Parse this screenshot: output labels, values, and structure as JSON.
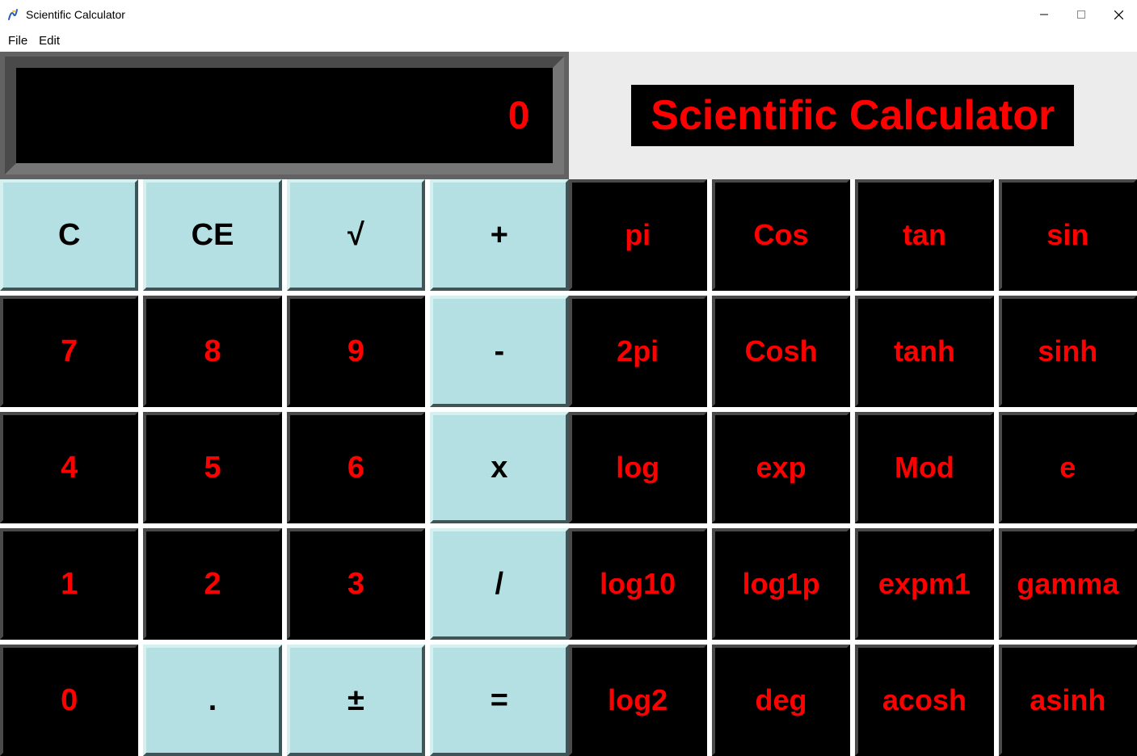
{
  "window": {
    "title": "Scientific Calculator"
  },
  "menu": {
    "file": "File",
    "edit": "Edit"
  },
  "display": {
    "value": "0"
  },
  "heading": "Scientific Calculator",
  "left_grid": [
    [
      {
        "label": "C",
        "style": "teal",
        "name": "clear-button"
      },
      {
        "label": "CE",
        "style": "teal",
        "name": "clear-entry-button"
      },
      {
        "label": "√",
        "style": "teal",
        "name": "sqrt-button"
      },
      {
        "label": "+",
        "style": "teal",
        "name": "plus-button"
      }
    ],
    [
      {
        "label": "7",
        "style": "black",
        "name": "digit-7-button"
      },
      {
        "label": "8",
        "style": "black",
        "name": "digit-8-button"
      },
      {
        "label": "9",
        "style": "black",
        "name": "digit-9-button"
      },
      {
        "label": "-",
        "style": "teal",
        "name": "minus-button"
      }
    ],
    [
      {
        "label": "4",
        "style": "black",
        "name": "digit-4-button"
      },
      {
        "label": "5",
        "style": "black",
        "name": "digit-5-button"
      },
      {
        "label": "6",
        "style": "black",
        "name": "digit-6-button"
      },
      {
        "label": "x",
        "style": "teal",
        "name": "multiply-button"
      }
    ],
    [
      {
        "label": "1",
        "style": "black",
        "name": "digit-1-button"
      },
      {
        "label": "2",
        "style": "black",
        "name": "digit-2-button"
      },
      {
        "label": "3",
        "style": "black",
        "name": "digit-3-button"
      },
      {
        "label": "/",
        "style": "teal",
        "name": "divide-button"
      }
    ],
    [
      {
        "label": "0",
        "style": "black",
        "name": "digit-0-button"
      },
      {
        "label": ".",
        "style": "teal",
        "name": "decimal-button"
      },
      {
        "label": "±",
        "style": "teal",
        "name": "plus-minus-button"
      },
      {
        "label": "=",
        "style": "teal",
        "name": "equals-button"
      }
    ]
  ],
  "right_grid": [
    [
      {
        "label": "pi",
        "name": "pi-button"
      },
      {
        "label": "Cos",
        "name": "cos-button"
      },
      {
        "label": "tan",
        "name": "tan-button"
      },
      {
        "label": "sin",
        "name": "sin-button"
      }
    ],
    [
      {
        "label": "2pi",
        "name": "two-pi-button"
      },
      {
        "label": "Cosh",
        "name": "cosh-button"
      },
      {
        "label": "tanh",
        "name": "tanh-button"
      },
      {
        "label": "sinh",
        "name": "sinh-button"
      }
    ],
    [
      {
        "label": "log",
        "name": "log-button"
      },
      {
        "label": "exp",
        "name": "exp-button"
      },
      {
        "label": "Mod",
        "name": "mod-button"
      },
      {
        "label": "e",
        "name": "e-button"
      }
    ],
    [
      {
        "label": "log10",
        "name": "log10-button"
      },
      {
        "label": "log1p",
        "name": "log1p-button"
      },
      {
        "label": "expm1",
        "name": "expm1-button"
      },
      {
        "label": "gamma",
        "name": "gamma-button"
      }
    ],
    [
      {
        "label": "log2",
        "name": "log2-button"
      },
      {
        "label": "deg",
        "name": "deg-button"
      },
      {
        "label": "acosh",
        "name": "acosh-button"
      },
      {
        "label": "asinh",
        "name": "asinh-button"
      }
    ]
  ]
}
